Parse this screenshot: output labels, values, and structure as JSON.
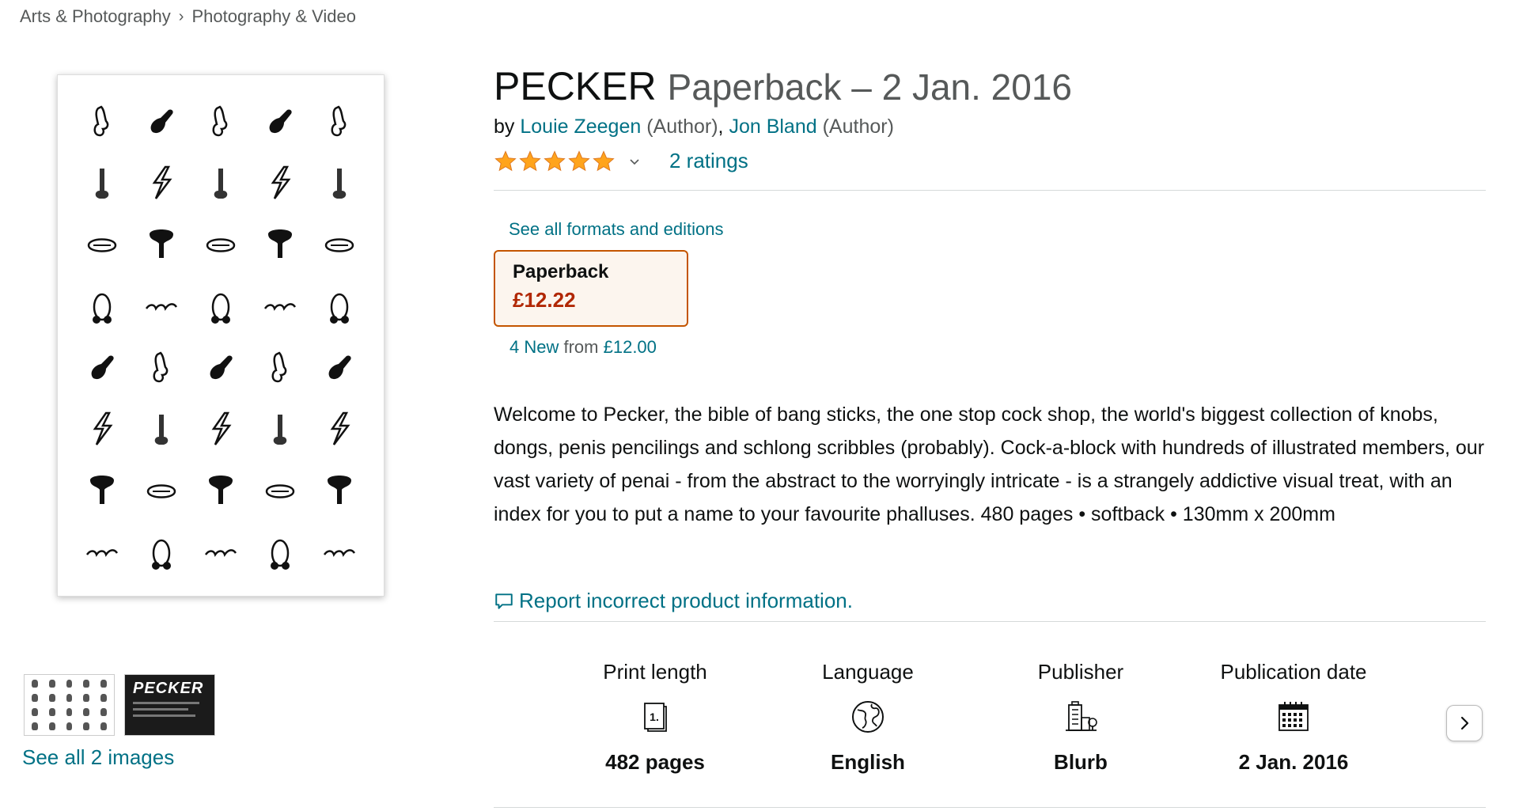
{
  "breadcrumb": {
    "items": [
      "Arts & Photography",
      "Photography & Video"
    ],
    "separator": "›"
  },
  "gallery": {
    "see_all_label": "See all 2 images",
    "cover_thumb_title": "PECKER"
  },
  "product": {
    "title": "PECKER",
    "subtitle": "Paperback – 2 Jan. 2016",
    "by_label": "by",
    "authors": [
      {
        "name": "Louie Zeegen",
        "role": "(Author)"
      },
      {
        "name": "Jon Bland",
        "role": "(Author)"
      }
    ],
    "rating_stars": 5,
    "ratings_label": "2 ratings",
    "star_color": "#ffa41c"
  },
  "formats": {
    "see_all_label": "See all formats and editions",
    "selected": {
      "name": "Paperback",
      "price": "£12.22"
    },
    "offers_count": "4 New",
    "offers_from": "from",
    "offers_price": "£12.00"
  },
  "description": "Welcome to Pecker, the bible of bang sticks, the one stop cock shop, the world's biggest collection of knobs, dongs, penis pencilings and schlong scribbles (probably). Cock-a-block with hundreds of illustrated members, our vast variety of penai - from the abstract to the worryingly intricate - is a strangely addictive visual treat, with an index for you to put a name to your favourite phalluses. 480 pages • softback • 130mm x 200mm",
  "report_label": "Report incorrect product information.",
  "details": [
    {
      "label": "Print length",
      "icon": "book-pages-icon",
      "value": "482 pages"
    },
    {
      "label": "Language",
      "icon": "globe-icon",
      "value": "English"
    },
    {
      "label": "Publisher",
      "icon": "building-icon",
      "value": "Blurb"
    },
    {
      "label": "Publication date",
      "icon": "calendar-icon",
      "value": "2 Jan. 2016"
    }
  ],
  "colors": {
    "link": "#007185",
    "price": "#b12704",
    "selected_border": "#c45500",
    "selected_bg": "#fcf5ee"
  }
}
